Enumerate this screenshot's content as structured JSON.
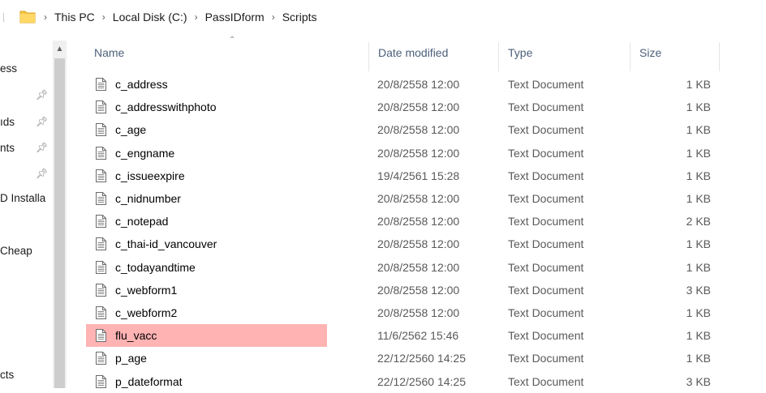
{
  "breadcrumb": {
    "items": [
      "This PC",
      "Local Disk (C:)",
      "PassIDform",
      "Scripts"
    ]
  },
  "nav": {
    "items": [
      "ess",
      "ıds",
      "nts",
      "D Installa",
      "Cheap",
      "cts"
    ]
  },
  "columns": {
    "name": "Name",
    "date": "Date modified",
    "type": "Type",
    "size": "Size"
  },
  "files": [
    {
      "name": "c_address",
      "date": "20/8/2558 12:00",
      "type": "Text Document",
      "size": "1 KB"
    },
    {
      "name": "c_addresswithphoto",
      "date": "20/8/2558 12:00",
      "type": "Text Document",
      "size": "1 KB"
    },
    {
      "name": "c_age",
      "date": "20/8/2558 12:00",
      "type": "Text Document",
      "size": "1 KB"
    },
    {
      "name": "c_engname",
      "date": "20/8/2558 12:00",
      "type": "Text Document",
      "size": "1 KB"
    },
    {
      "name": "c_issueexpire",
      "date": "19/4/2561 15:28",
      "type": "Text Document",
      "size": "1 KB"
    },
    {
      "name": "c_nidnumber",
      "date": "20/8/2558 12:00",
      "type": "Text Document",
      "size": "1 KB"
    },
    {
      "name": "c_notepad",
      "date": "20/8/2558 12:00",
      "type": "Text Document",
      "size": "2 KB"
    },
    {
      "name": "c_thai-id_vancouver",
      "date": "20/8/2558 12:00",
      "type": "Text Document",
      "size": "1 KB"
    },
    {
      "name": "c_todayandtime",
      "date": "20/8/2558 12:00",
      "type": "Text Document",
      "size": "1 KB"
    },
    {
      "name": "c_webform1",
      "date": "20/8/2558 12:00",
      "type": "Text Document",
      "size": "3 KB"
    },
    {
      "name": "c_webform2",
      "date": "20/8/2558 12:00",
      "type": "Text Document",
      "size": "1 KB"
    },
    {
      "name": "flu_vacc",
      "date": "11/6/2562 15:46",
      "type": "Text Document",
      "size": "1 KB",
      "selected": true
    },
    {
      "name": "p_age",
      "date": "22/12/2560 14:25",
      "type": "Text Document",
      "size": "1 KB"
    },
    {
      "name": "p_dateformat",
      "date": "22/12/2560 14:25",
      "type": "Text Document",
      "size": "3 KB"
    }
  ],
  "colors": {
    "selection": "#ffb3b3",
    "header_text": "#4c607a",
    "folder": "#f4c542"
  },
  "icons": {
    "folder": "folder-icon",
    "file": "text-file-icon",
    "pin": "pin-icon"
  }
}
